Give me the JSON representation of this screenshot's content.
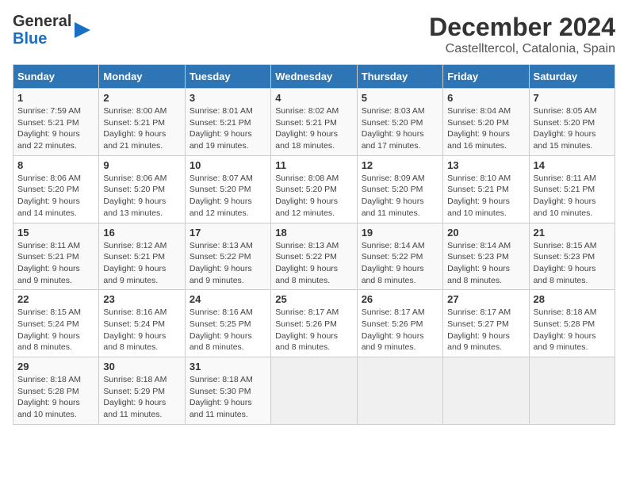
{
  "header": {
    "logo_line1": "General",
    "logo_line2": "Blue",
    "title": "December 2024",
    "subtitle": "Castelltercol, Catalonia, Spain"
  },
  "weekdays": [
    "Sunday",
    "Monday",
    "Tuesday",
    "Wednesday",
    "Thursday",
    "Friday",
    "Saturday"
  ],
  "weeks": [
    [
      {
        "day": "1",
        "text": "Sunrise: 7:59 AM\nSunset: 5:21 PM\nDaylight: 9 hours\nand 22 minutes."
      },
      {
        "day": "2",
        "text": "Sunrise: 8:00 AM\nSunset: 5:21 PM\nDaylight: 9 hours\nand 21 minutes."
      },
      {
        "day": "3",
        "text": "Sunrise: 8:01 AM\nSunset: 5:21 PM\nDaylight: 9 hours\nand 19 minutes."
      },
      {
        "day": "4",
        "text": "Sunrise: 8:02 AM\nSunset: 5:21 PM\nDaylight: 9 hours\nand 18 minutes."
      },
      {
        "day": "5",
        "text": "Sunrise: 8:03 AM\nSunset: 5:20 PM\nDaylight: 9 hours\nand 17 minutes."
      },
      {
        "day": "6",
        "text": "Sunrise: 8:04 AM\nSunset: 5:20 PM\nDaylight: 9 hours\nand 16 minutes."
      },
      {
        "day": "7",
        "text": "Sunrise: 8:05 AM\nSunset: 5:20 PM\nDaylight: 9 hours\nand 15 minutes."
      }
    ],
    [
      {
        "day": "8",
        "text": "Sunrise: 8:06 AM\nSunset: 5:20 PM\nDaylight: 9 hours\nand 14 minutes."
      },
      {
        "day": "9",
        "text": "Sunrise: 8:06 AM\nSunset: 5:20 PM\nDaylight: 9 hours\nand 13 minutes."
      },
      {
        "day": "10",
        "text": "Sunrise: 8:07 AM\nSunset: 5:20 PM\nDaylight: 9 hours\nand 12 minutes."
      },
      {
        "day": "11",
        "text": "Sunrise: 8:08 AM\nSunset: 5:20 PM\nDaylight: 9 hours\nand 12 minutes."
      },
      {
        "day": "12",
        "text": "Sunrise: 8:09 AM\nSunset: 5:20 PM\nDaylight: 9 hours\nand 11 minutes."
      },
      {
        "day": "13",
        "text": "Sunrise: 8:10 AM\nSunset: 5:21 PM\nDaylight: 9 hours\nand 10 minutes."
      },
      {
        "day": "14",
        "text": "Sunrise: 8:11 AM\nSunset: 5:21 PM\nDaylight: 9 hours\nand 10 minutes."
      }
    ],
    [
      {
        "day": "15",
        "text": "Sunrise: 8:11 AM\nSunset: 5:21 PM\nDaylight: 9 hours\nand 9 minutes."
      },
      {
        "day": "16",
        "text": "Sunrise: 8:12 AM\nSunset: 5:21 PM\nDaylight: 9 hours\nand 9 minutes."
      },
      {
        "day": "17",
        "text": "Sunrise: 8:13 AM\nSunset: 5:22 PM\nDaylight: 9 hours\nand 9 minutes."
      },
      {
        "day": "18",
        "text": "Sunrise: 8:13 AM\nSunset: 5:22 PM\nDaylight: 9 hours\nand 8 minutes."
      },
      {
        "day": "19",
        "text": "Sunrise: 8:14 AM\nSunset: 5:22 PM\nDaylight: 9 hours\nand 8 minutes."
      },
      {
        "day": "20",
        "text": "Sunrise: 8:14 AM\nSunset: 5:23 PM\nDaylight: 9 hours\nand 8 minutes."
      },
      {
        "day": "21",
        "text": "Sunrise: 8:15 AM\nSunset: 5:23 PM\nDaylight: 9 hours\nand 8 minutes."
      }
    ],
    [
      {
        "day": "22",
        "text": "Sunrise: 8:15 AM\nSunset: 5:24 PM\nDaylight: 9 hours\nand 8 minutes."
      },
      {
        "day": "23",
        "text": "Sunrise: 8:16 AM\nSunset: 5:24 PM\nDaylight: 9 hours\nand 8 minutes."
      },
      {
        "day": "24",
        "text": "Sunrise: 8:16 AM\nSunset: 5:25 PM\nDaylight: 9 hours\nand 8 minutes."
      },
      {
        "day": "25",
        "text": "Sunrise: 8:17 AM\nSunset: 5:26 PM\nDaylight: 9 hours\nand 8 minutes."
      },
      {
        "day": "26",
        "text": "Sunrise: 8:17 AM\nSunset: 5:26 PM\nDaylight: 9 hours\nand 9 minutes."
      },
      {
        "day": "27",
        "text": "Sunrise: 8:17 AM\nSunset: 5:27 PM\nDaylight: 9 hours\nand 9 minutes."
      },
      {
        "day": "28",
        "text": "Sunrise: 8:18 AM\nSunset: 5:28 PM\nDaylight: 9 hours\nand 9 minutes."
      }
    ],
    [
      {
        "day": "29",
        "text": "Sunrise: 8:18 AM\nSunset: 5:28 PM\nDaylight: 9 hours\nand 10 minutes."
      },
      {
        "day": "30",
        "text": "Sunrise: 8:18 AM\nSunset: 5:29 PM\nDaylight: 9 hours\nand 11 minutes."
      },
      {
        "day": "31",
        "text": "Sunrise: 8:18 AM\nSunset: 5:30 PM\nDaylight: 9 hours\nand 11 minutes."
      },
      {
        "day": "",
        "text": ""
      },
      {
        "day": "",
        "text": ""
      },
      {
        "day": "",
        "text": ""
      },
      {
        "day": "",
        "text": ""
      }
    ]
  ]
}
